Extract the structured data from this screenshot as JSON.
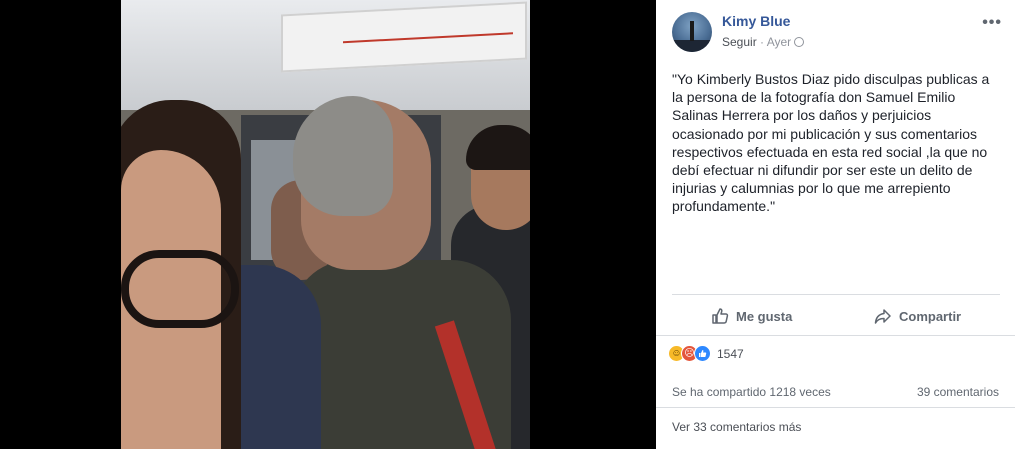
{
  "post": {
    "author": "Kimy Blue",
    "follow_label": "Seguir",
    "separator": " · ",
    "time": "Ayer",
    "menu_glyph": "•••",
    "text": "\"Yo Kimberly Bustos Diaz pido disculpas publicas a la persona de la fotografía don Samuel Emilio Salinas Herrera por los daños y perjuicios ocasionado por mi publicación y sus comentarios respectivos efectuada en esta red social ,la que no debí efectuar ni difundir por ser este un delito de injurias y calumnias por lo que me arrepiento profundamente.\""
  },
  "actions": {
    "like_label": "Me gusta",
    "share_label": "Compartir"
  },
  "reactions": {
    "icons": [
      "haha-icon",
      "angry-icon",
      "like-icon"
    ],
    "count": "1547"
  },
  "stats": {
    "shares": "Se ha compartido 1218 veces",
    "comments": "39 comentarios",
    "more_comments": "Ver 33 comentarios más"
  },
  "colors": {
    "link": "#365899",
    "secondary_text": "#90949c",
    "body_text": "#1d2129",
    "like_blue": "#2d88ff",
    "angry_red": "#e4563b",
    "haha_yellow": "#f7b928"
  }
}
